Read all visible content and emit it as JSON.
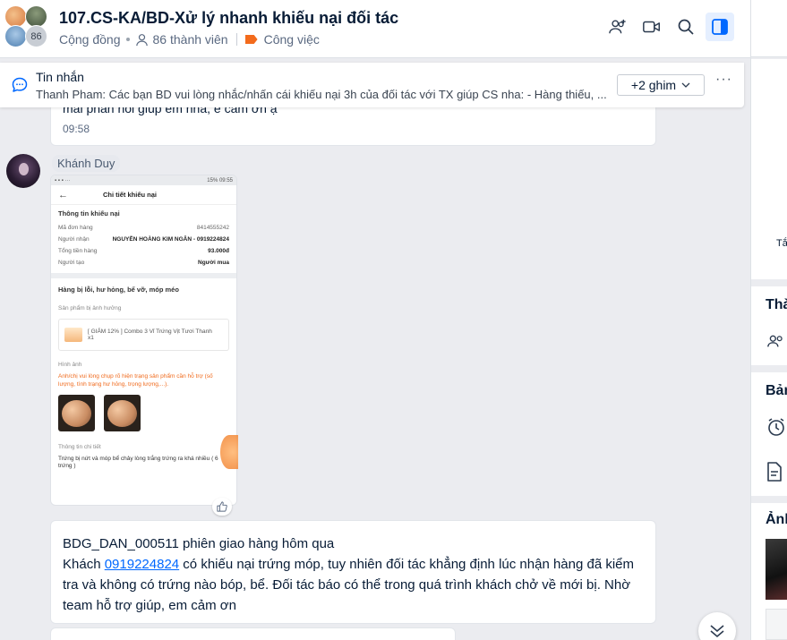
{
  "header": {
    "member_badge": "86",
    "title": "107.CS-KA/BD-Xử lý nhanh khiếu nại đối tác",
    "community_label": "Cộng đồng",
    "members_label": "86 thành viên",
    "tag_label": "Công việc",
    "actions": [
      "add-member-icon",
      "video-call-icon",
      "search-icon",
      "panel-toggle-icon"
    ]
  },
  "pinned": {
    "title": "Tin nhắn",
    "text": "Thanh Pham: Các bạn BD vui lòng nhắc/nhấn cái khiếu nại 3h của đối tác với TX giúp CS nha: - Hàng thiếu, ...",
    "more_label": "+2 ghim"
  },
  "previous_message": {
    "partial_text": "mái phần hỗi giúp em nha, e cảm ơn ạ",
    "time": "09:58"
  },
  "sender": {
    "name": "Khánh Duy"
  },
  "screenshot": {
    "status_right": "15% 09:55",
    "screen_title": "Chi tiết khiếu nại",
    "section_title": "Thông tin khiếu nại",
    "rows": [
      {
        "label": "Mã đơn hàng",
        "value": "8414555242"
      },
      {
        "label": "Người nhận",
        "value": "NGUYỄN HOÀNG KIM NGÂN - 0919224824"
      },
      {
        "label": "Tổng tiền hàng",
        "value": "93.000đ"
      },
      {
        "label": "Người tạo",
        "value": "Người mua"
      }
    ],
    "issue_title": "Hàng bị lỗi, hư hỏng, bể vỡ, móp méo",
    "affected_label": "Sản phẩm bị ảnh hưởng",
    "product_text": "[ GIẢM 12% ] Combo 3 Vỉ Trứng Vịt Tươi Thanh",
    "product_qty": "x1",
    "images_label": "Hình ảnh",
    "images_hint": "Anh/chị vui lòng chụp rõ hiện trạng sản phẩm cần hỗ trợ (số lượng, tình trạng hư hỏng, trọng lượng,...).",
    "detail_label": "Thông tin chi tiết",
    "detail_text": "Trứng bị nứt và móp bể chảy lòng trắng trứng ra khá nhiều ( 6 trứng )"
  },
  "message": {
    "line1": "BDG_DAN_000511 phiên giao hàng hôm qua",
    "line2_prefix": "Khách ",
    "phone": "0919224824",
    "line2_suffix": " có khiếu nại trứng móp, tuy nhiên đối tác khẳng định lúc nhận hàng đã kiểm tra và không có trứng nào bóp, bể. Đối tác báo có thể trong quá trình khách chở về mới bị. Nhờ team hỗ trợ giúp, em cảm ơn"
  },
  "right_panel": {
    "partial_label_1": "Tắ",
    "section_members": "Thà",
    "section_board": "Bản",
    "section_media": "Ảnh"
  }
}
